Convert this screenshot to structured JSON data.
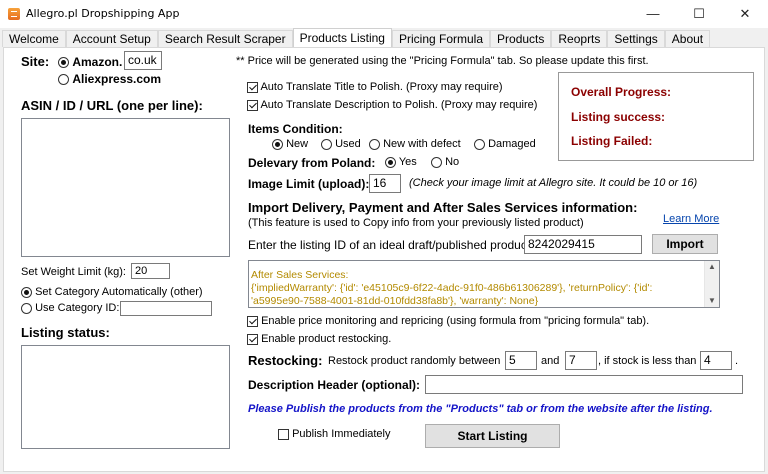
{
  "window": {
    "title": "Allegro.pl Dropshipping App",
    "minimize": "—",
    "maximize": "☐",
    "close": "✕"
  },
  "tabs": [
    "Welcome",
    "Account Setup",
    "Search Result Scraper",
    "Products Listing",
    "Pricing Formula",
    "Products",
    "Reoprts",
    "Settings",
    "About"
  ],
  "active_tab": "Products Listing",
  "site": {
    "label": "Site:",
    "amazon": "Amazon.",
    "amazon_domain": "co.uk",
    "aliexpress": "Aliexpress.com"
  },
  "asin_label": "ASIN / ID / URL (one per line):",
  "weight_limit": {
    "label": "Set Weight Limit (kg):",
    "value": "20"
  },
  "category": {
    "auto": "Set Category Automatically (other)",
    "manual": "Use Category ID:",
    "manual_value": ""
  },
  "listing_status_label": "Listing status:",
  "price_note": "** Price will be generated using the \"Pricing Formula\" tab. So please update this first.",
  "translate_title": "Auto Translate Title to Polish. (Proxy may require)",
  "translate_desc": "Auto Translate Description to Polish. (Proxy may require)",
  "progress": {
    "overall": "Overall Progress:",
    "success": "Listing success:",
    "failed": "Listing Failed:"
  },
  "condition": {
    "label": "Items Condition:",
    "options": [
      "New",
      "Used",
      "New with defect",
      "Damaged"
    ],
    "selected": "New"
  },
  "delivery": {
    "label": "Delevary from Poland:",
    "yes": "Yes",
    "no": "No",
    "selected": "Yes"
  },
  "image_limit": {
    "label": "Image Limit (upload):",
    "value": "16",
    "hint": "(Check your image limit at Allegro site. It could be 10 or 16)"
  },
  "import": {
    "heading": "Import Delivery, Payment and After Sales Services information:",
    "subtext": "(This feature is used to Copy info from your previously listed product)",
    "learn_more": "Learn More",
    "id_label": "Enter the listing ID of an ideal draft/published product:",
    "id_value": "8242029415",
    "button": "Import",
    "after_sales_line1": "After Sales Services:",
    "after_sales_line2": "{'impliedWarranty': {'id': 'e45105c9-6f22-4adc-91f0-486b61306289'}, 'returnPolicy': {'id':",
    "after_sales_line3": "'a5995e90-7588-4001-81dd-010fdd38fa8b'}, 'warranty': None}"
  },
  "price_monitoring": "Enable price monitoring and repricing (using formula from \"pricing formula\" tab).",
  "restocking_enable": "Enable product restocking.",
  "restocking": {
    "label": "Restocking:",
    "text1": "Restock product randomly between",
    "min": "5",
    "and": "and",
    "max": "7",
    "text2": ", if stock is less than",
    "threshold": "4",
    "end": "."
  },
  "description_header": {
    "label": "Description Header (optional):",
    "value": ""
  },
  "publish_note": "Please Publish the products from the \"Products\" tab or from the website after the listing.",
  "publish_immediately": "Publish Immediately",
  "start_button": "Start Listing"
}
